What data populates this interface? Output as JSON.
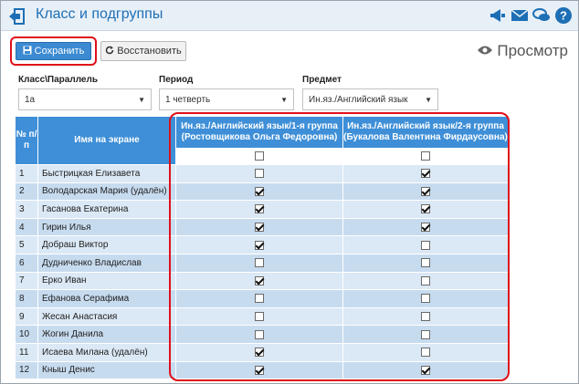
{
  "header": {
    "title": "Класс и подгруппы",
    "icons": [
      "back-icon",
      "megaphone-icon",
      "mail-icon",
      "chat-icon",
      "help-icon"
    ]
  },
  "toolbar": {
    "save_label": "Сохранить",
    "restore_label": "Восстановить",
    "preview_label": "Просмотр"
  },
  "filters": {
    "class_label": "Класс\\Параллель",
    "class_value": "1а",
    "period_label": "Период",
    "period_value": "1 четверть",
    "subject_label": "Предмет",
    "subject_value": "Ин.яз./Английский язык"
  },
  "table": {
    "col_num": "№ п/п",
    "col_name": "Имя на экране",
    "group1": "Ин.яз./Английский язык/1-я группа (Ростовщикова Ольга Федоровна)",
    "group2": "Ин.яз./Английский язык/2-я группа (Букалова Валентина Фирдаусовна)",
    "header_checks": [
      false,
      false
    ],
    "rows": [
      {
        "num": "1",
        "name": "Быстрицкая Елизавета",
        "g1": false,
        "g2": true
      },
      {
        "num": "2",
        "name": "Володарская Мария (удалён)",
        "g1": true,
        "g2": true
      },
      {
        "num": "3",
        "name": "Гасанова Екатерина",
        "g1": true,
        "g2": true
      },
      {
        "num": "4",
        "name": "Гирин Илья",
        "g1": true,
        "g2": true
      },
      {
        "num": "5",
        "name": "Добраш Виктор",
        "g1": true,
        "g2": false
      },
      {
        "num": "6",
        "name": "Дудниченко Владислав",
        "g1": false,
        "g2": false
      },
      {
        "num": "7",
        "name": "Ерко Иван",
        "g1": true,
        "g2": false
      },
      {
        "num": "8",
        "name": "Ефанова Серафима",
        "g1": false,
        "g2": false
      },
      {
        "num": "9",
        "name": "Жесан Анастасия",
        "g1": false,
        "g2": false
      },
      {
        "num": "10",
        "name": "Жогин Данила",
        "g1": false,
        "g2": false
      },
      {
        "num": "11",
        "name": "Исаева Милана (удалён)",
        "g1": true,
        "g2": false
      },
      {
        "num": "12",
        "name": "Кныш Денис",
        "g1": true,
        "g2": true
      }
    ]
  },
  "colors": {
    "accent": "#1d6fb5",
    "header_bg": "#3e8fd7",
    "highlight": "#e0101a"
  }
}
